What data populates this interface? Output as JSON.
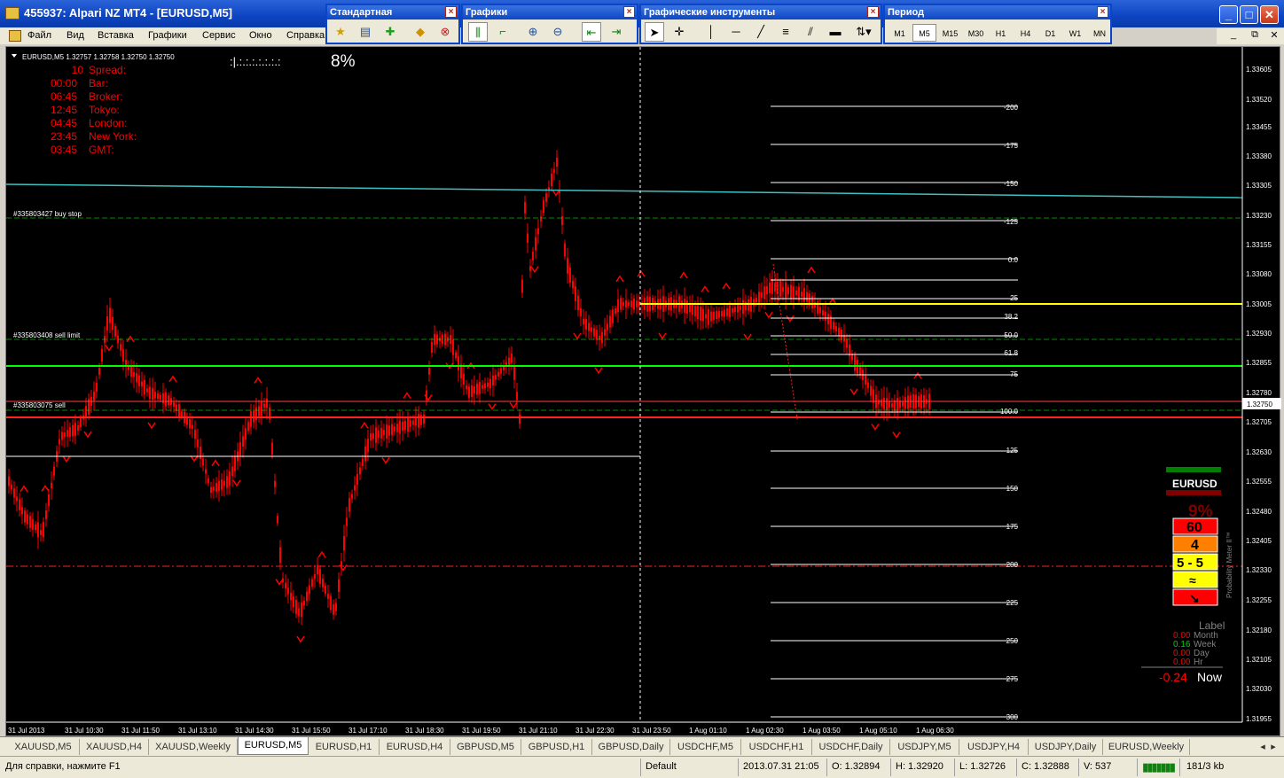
{
  "window": {
    "title": "455937: Alpari NZ MT4 - [EURUSD,M5]"
  },
  "menu": [
    "Файл",
    "Вид",
    "Вставка",
    "Графики",
    "Сервис",
    "Окно",
    "Справка"
  ],
  "toolbars": {
    "standard": {
      "title": "Стандартная"
    },
    "charts": {
      "title": "Графики"
    },
    "tools": {
      "title": "Графические инструменты"
    },
    "period": {
      "title": "Период",
      "items": [
        "M1",
        "M5",
        "M15",
        "M30",
        "H1",
        "H4",
        "D1",
        "W1",
        "MN"
      ],
      "active": "M5"
    }
  },
  "chart": {
    "header": "EURUSD,M5  1.32757 1.32758 1.32750 1.32750",
    "spread_widget": {
      "bar": ":|.:.:.:.:.:.:.:",
      "percent": "8%"
    },
    "info_panel": {
      "times": [
        "10",
        "00:00",
        "06:45",
        "12:45",
        "04:45",
        "23:45",
        "03:45"
      ],
      "labels": [
        "Spread:",
        "Bar:",
        "Broker:",
        "Tokyo:",
        "London:",
        "New York:",
        "GMT:"
      ]
    },
    "price_axis": [
      "1.33605",
      "1.33520",
      "1.33455",
      "1.33380",
      "1.33305",
      "1.33230",
      "1.33155",
      "1.33080",
      "1.33005",
      "1.32930",
      "1.32855",
      "1.32780",
      "1.32705",
      "1.32630",
      "1.32555",
      "1.32480",
      "1.32405",
      "1.32330",
      "1.32255",
      "1.32180",
      "1.32105",
      "1.32030",
      "1.31955"
    ],
    "current_price": "1.32750",
    "time_axis": [
      "31 Jul 2013",
      "31 Jul 10:30",
      "31 Jul 11:50",
      "31 Jul 13:10",
      "31 Jul 14:30",
      "31 Jul 15:50",
      "31 Jul 17:10",
      "31 Jul 18:30",
      "31 Jul 19:50",
      "31 Jul 21:10",
      "31 Jul 22:30",
      "31 Jul 23:50",
      "1 Aug 01:10",
      "1 Aug 02:30",
      "1 Aug 03:50",
      "1 Aug 05:10",
      "1 Aug 06:30"
    ],
    "order_labels": [
      "#335803427 buy stop",
      "#335803408 sell limit",
      "#335803075 sell"
    ],
    "fib_levels": [
      "-200",
      "-175",
      "-150",
      "-125",
      "0.0",
      "25",
      "38.2",
      "50.0",
      "61.8",
      "75",
      "100.0",
      "125",
      "150",
      "175",
      "200",
      "225",
      "250",
      "275",
      "300"
    ],
    "colors": {
      "candles": "#ff0000",
      "green_level": "#00ff00",
      "yellow_level": "#ffff00",
      "trend": "#40c0c0"
    }
  },
  "meter": {
    "symbol": "EURUSD",
    "percent": "9%",
    "cells": [
      "60",
      "4",
      "5 - 5",
      "≈",
      "↘"
    ],
    "side_label": "Probability Meter II™",
    "label_title": "Label",
    "rows": [
      {
        "value": "0.00",
        "period": "Month",
        "color": "#ff0000"
      },
      {
        "value": "0.16",
        "period": "Week",
        "color": "#00d000"
      },
      {
        "value": "0.00",
        "period": "Day",
        "color": "#ff0000"
      },
      {
        "value": "0.00",
        "period": "Hr",
        "color": "#ff0000"
      }
    ],
    "now_value": "-0.24",
    "now_label": "Now"
  },
  "tabs": [
    "XAUUSD,M5",
    "XAUUSD,H4",
    "XAUUSD,Weekly",
    "EURUSD,M5",
    "EURUSD,H1",
    "EURUSD,H4",
    "GBPUSD,M5",
    "GBPUSD,H1",
    "GBPUSD,Daily",
    "USDCHF,M5",
    "USDCHF,H1",
    "USDCHF,Daily",
    "USDJPY,M5",
    "USDJPY,H4",
    "USDJPY,Daily",
    "EURUSD,Weekly"
  ],
  "active_tab": "EURUSD,M5",
  "status": {
    "help": "Для справки, нажмите F1",
    "profile": "Default",
    "datetime": "2013.07.31 21:05",
    "open": "O: 1.32894",
    "high": "H: 1.32920",
    "low": "L: 1.32726",
    "close": "C: 1.32888",
    "volume": "V: 537",
    "traffic": "181/3 kb"
  }
}
